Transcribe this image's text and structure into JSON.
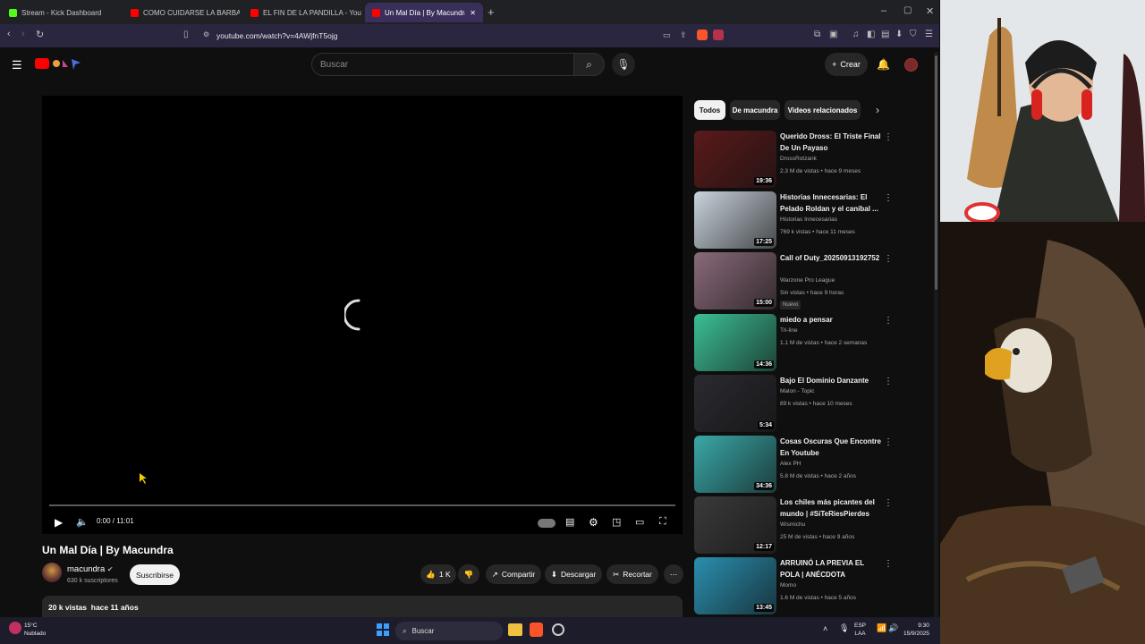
{
  "browser": {
    "tabs": [
      {
        "label": "Stream - Kick Dashboard",
        "color": "#53fc18"
      },
      {
        "label": "COMO CUIDARSE LA BARBA - YouTu",
        "color": "#ff0000"
      },
      {
        "label": "EL FIN DE LA PANDILLA - YouTube",
        "color": "#ff0000"
      },
      {
        "label": "Un Mal Día | By Macundra - You",
        "color": "#ff0000"
      }
    ],
    "new_tab": "+",
    "url": "youtube.com/watch?v=4AWjfnT5ojg",
    "window_controls": {
      "minimize": "–",
      "maximize": "▢",
      "close": "✕"
    }
  },
  "youtube": {
    "search_placeholder": "Buscar",
    "create_label": "Crear",
    "player": {
      "time": "0:00 / 11:01",
      "progress": 0
    },
    "video": {
      "title": "Un Mal Día | By Macundra",
      "channel": "macundra",
      "subscribers": "630 k suscriptores",
      "subscribe_label": "Suscribirse",
      "likes": "1 K",
      "share_label": "Compartir",
      "download_label": "Descargar",
      "clip_label": "Recortar",
      "views": "20 k vistas",
      "age": "hace 11 años"
    },
    "chips": [
      "Todos",
      "De macundra",
      "Videos relacionados"
    ],
    "recommendations": [
      {
        "title": "Querido Dross: El Triste Final De Un Payaso",
        "channel": "DrossRotzank",
        "meta": "2.3 M de vistas • hace 9 meses",
        "duration": "19:36",
        "thumb": "#5a1a1a"
      },
      {
        "title": "Historias Innecesarias: El Pelado Roldan y el caníbal ...",
        "channel": "Historias Innecesarias",
        "meta": "769 k vistas • hace 11 meses",
        "duration": "17:25",
        "thumb": "#c9d3dc"
      },
      {
        "title": "Call of Duty_20250913192752",
        "channel": "Warzone Pro League",
        "meta": "Sin vistas • hace 9 horas",
        "duration": "15:00",
        "thumb": "#8a6a7a",
        "badge": "Nuevo"
      },
      {
        "title": "miedo a pensar",
        "channel": "Tri-line",
        "meta": "1.1 M de vistas • hace 2 semanas",
        "duration": "14:36",
        "thumb": "#3bbf95"
      },
      {
        "title": "Bajo El Dominio Danzante",
        "channel": "Malon - Topic",
        "meta": "89 k vistas • hace 10 meses",
        "duration": "5:34",
        "thumb": "#2a2a30"
      },
      {
        "title": "Cosas Oscuras Que Encontre En Youtube",
        "channel": "Alex PH",
        "meta": "5.8 M de vistas • hace 2 años",
        "duration": "34:36",
        "thumb": "#3aa8a8"
      },
      {
        "title": "Los chiles más picantes del mundo | #SiTeRiesPierdes",
        "channel": "Wismichu",
        "meta": "25 M de vistas • hace 9 años",
        "duration": "12:17",
        "thumb": "#3a3a3a"
      },
      {
        "title": "ARRUINÓ LA PREVIA EL POLA | ANÉCDOTA",
        "channel": "Momo",
        "meta": "1.6 M de vistas • hace 5 años",
        "duration": "13:45",
        "thumb": "#2a8fb0"
      }
    ]
  },
  "taskbar": {
    "weather_temp": "15°C",
    "weather_text": "Nublado",
    "search_label": "Buscar",
    "lang": "ESP",
    "lang_sub": "LAA",
    "time": "9:30",
    "date": "15/9/2025"
  }
}
